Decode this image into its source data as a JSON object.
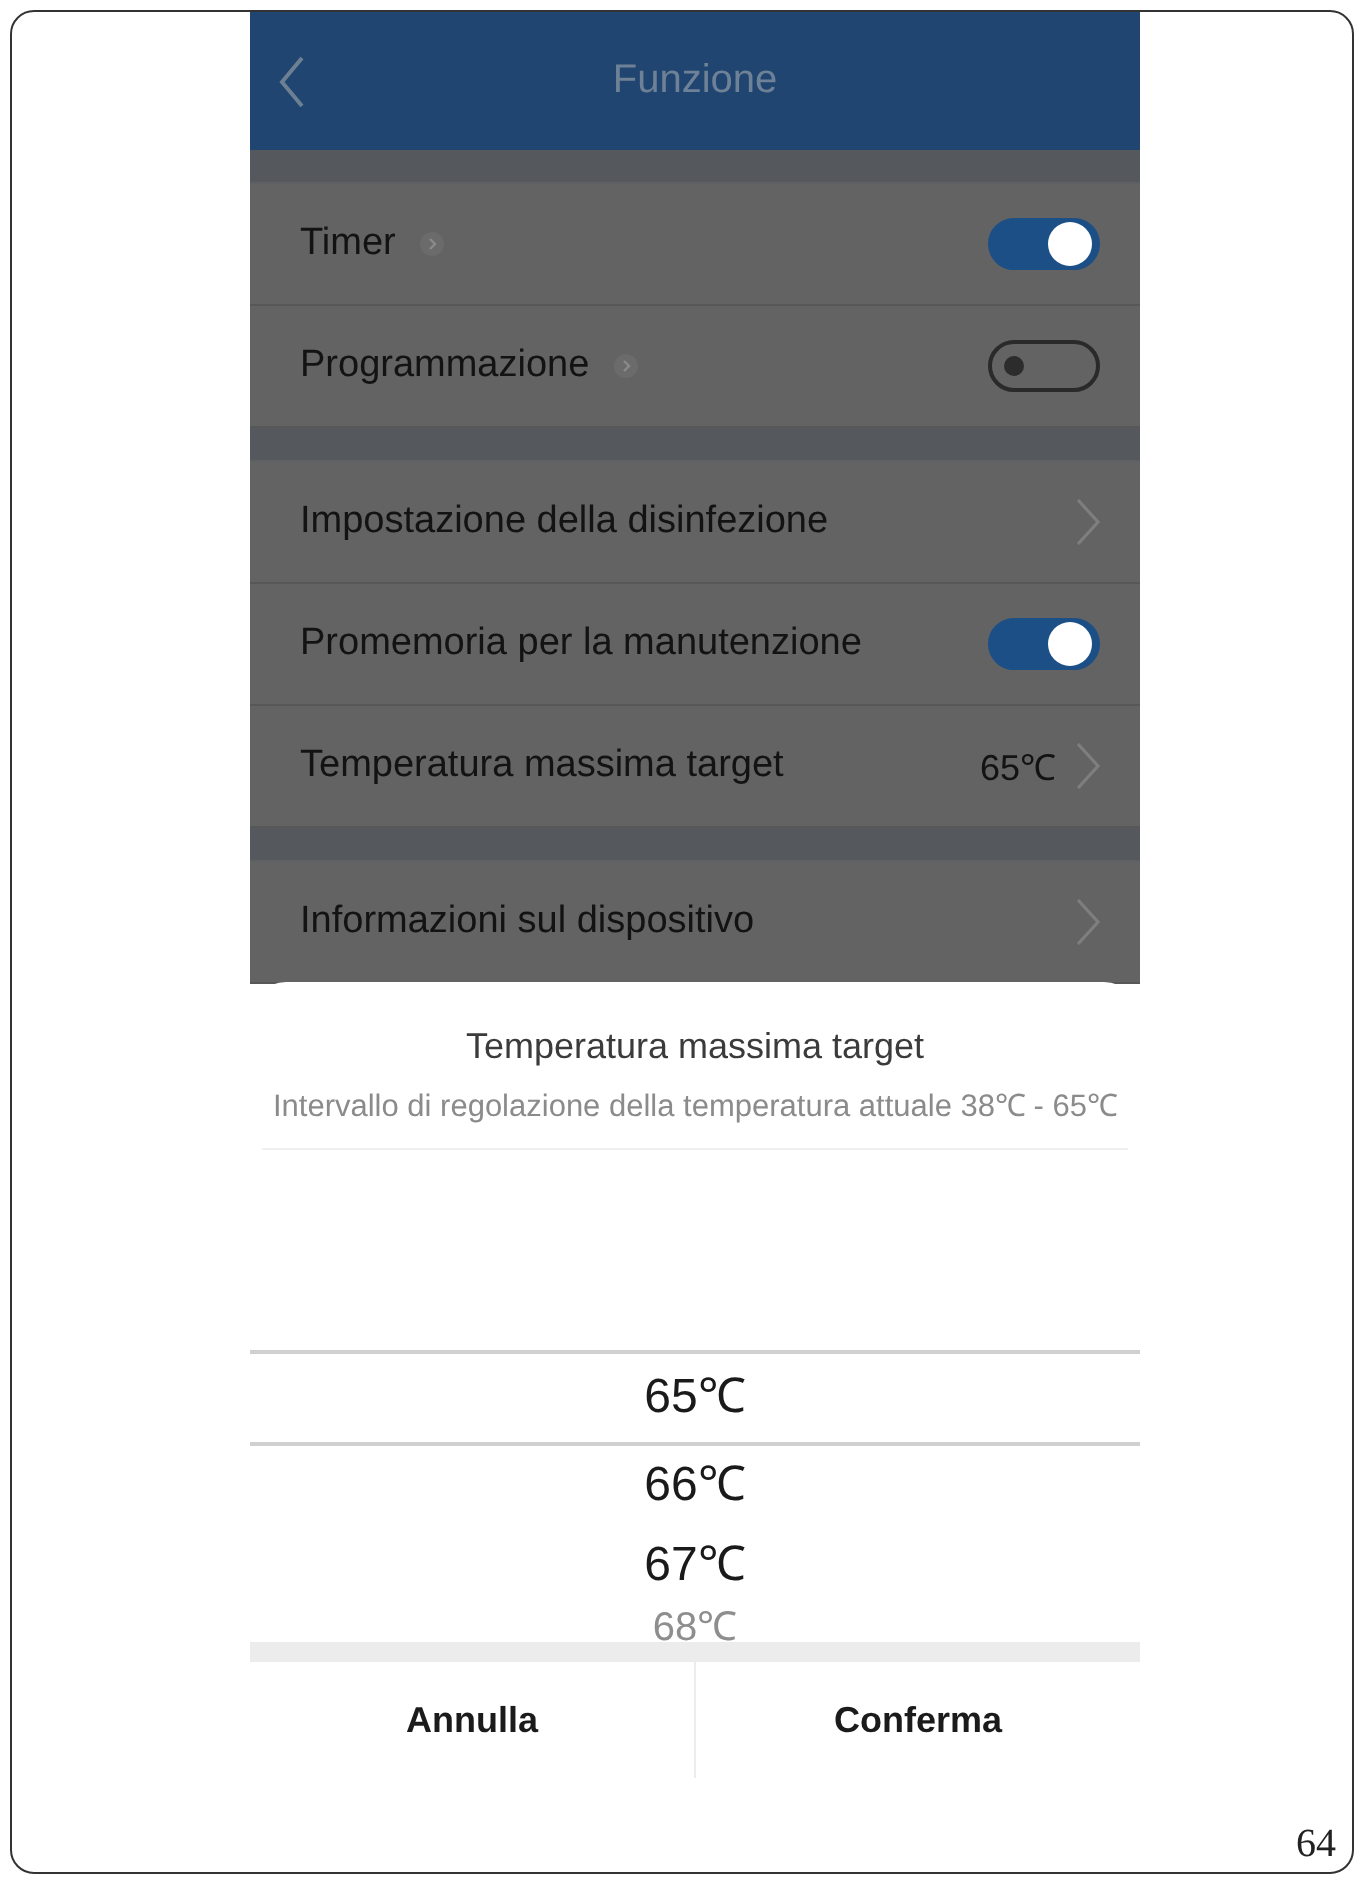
{
  "header": {
    "title": "Funzione"
  },
  "sections": [
    {
      "items": [
        {
          "label": "Timer",
          "kind": "toggle",
          "on": true,
          "info_arrow": true
        },
        {
          "label": "Programmazione",
          "kind": "toggle",
          "on": false,
          "info_arrow": true
        }
      ]
    },
    {
      "items": [
        {
          "label": "Impostazione della disinfezione",
          "kind": "link"
        },
        {
          "label": "Promemoria per la manutenzione",
          "kind": "toggle",
          "on": true,
          "info_arrow": false
        },
        {
          "label": "Temperatura massima target",
          "kind": "value",
          "value": "65℃"
        }
      ]
    },
    {
      "items": [
        {
          "label": "Informazioni sul dispositivo",
          "kind": "link"
        }
      ]
    }
  ],
  "sheet": {
    "title": "Temperatura massima target",
    "subtitle": "Intervallo di regolazione della temperatura attuale 38℃ - 65℃",
    "options": [
      {
        "label": "65℃",
        "selected": true
      },
      {
        "label": "66℃",
        "selected": false
      },
      {
        "label": "67℃",
        "selected": false
      },
      {
        "label": "68℃",
        "selected": false
      }
    ],
    "buttons": [
      {
        "label": "Annulla",
        "kind": "cancel"
      },
      {
        "label": "Conferma",
        "kind": "confirm"
      }
    ]
  },
  "page_number": "64"
}
